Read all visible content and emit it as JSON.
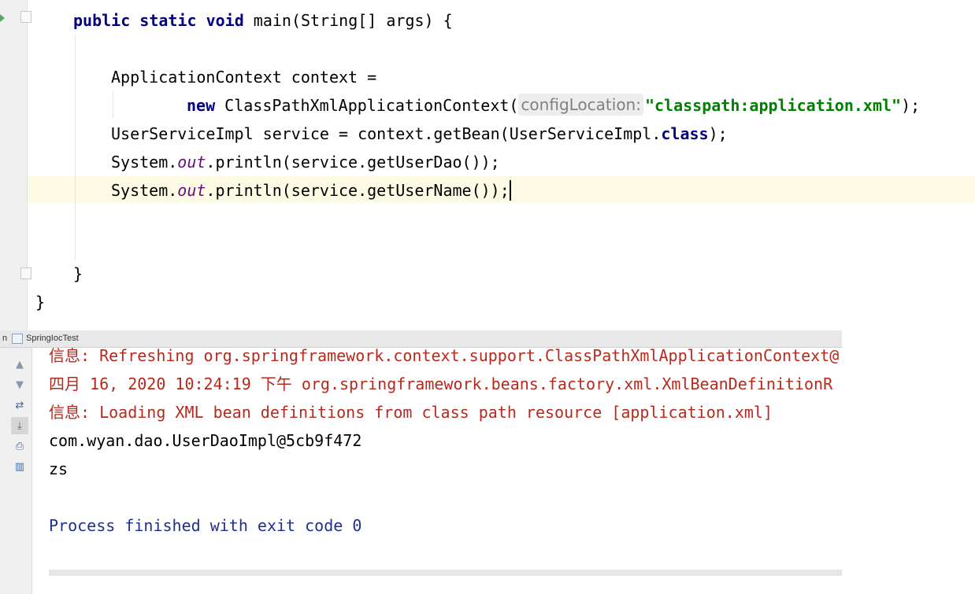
{
  "editor": {
    "lines": {
      "main_sig": {
        "kw": "public static void",
        "rest": " main(String[] args) {"
      },
      "ctx_decl": "ApplicationContext context =",
      "ctx_new": {
        "kw": "new",
        "cls": " ClassPathXmlApplicationContext(",
        "hint": "configLocation:",
        "str": "\"classpath:application.xml\"",
        "end": ");"
      },
      "get_bean": {
        "pre": "UserServiceImpl service = context.getBean(UserServiceImpl.",
        "kw": "class",
        "end": ");"
      },
      "print_dao": {
        "pre": "System.",
        "field": "out",
        "rest": ".println(service.getUserDao());"
      },
      "print_name": {
        "pre": "System.",
        "field": "out",
        "rest": ".println(service.getUserName());"
      },
      "close_method": "}",
      "close_class": "}"
    }
  },
  "run_window": {
    "tab_prefix": "n",
    "config_name": "SpringIocTest",
    "toolbar_icons": [
      "arrow-up-icon",
      "arrow-down-icon",
      "soft-wrap-icon",
      "scroll-to-end-icon",
      "print-icon",
      "trash-icon"
    ],
    "console": {
      "line1": "信息: Refreshing org.springframework.context.support.ClassPathXmlApplicationContext@",
      "line2": "四月 16, 2020 10:24:19 下午 org.springframework.beans.factory.xml.XmlBeanDefinitionR",
      "line3": "信息: Loading XML bean definitions from class path resource [application.xml]",
      "line4": "com.wyan.dao.UserDaoImpl@5cb9f472",
      "line5": "zs",
      "line6": "Process finished with exit code 0"
    }
  },
  "colors": {
    "keyword": "#000080",
    "string": "#008000",
    "static_field": "#660e7a",
    "console_error": "#b52a1d",
    "console_info": "#1f2f8f",
    "current_line": "#fdfbe4"
  }
}
